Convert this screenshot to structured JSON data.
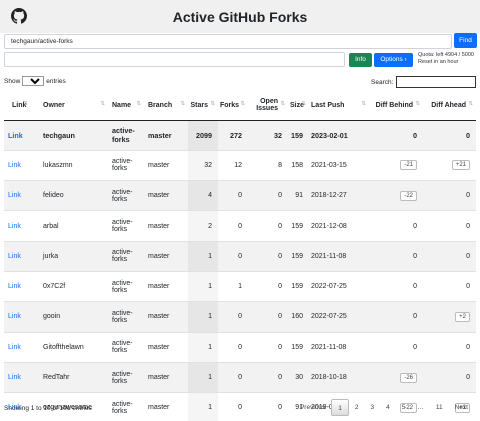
{
  "header": {
    "title": "Active GitHub Forks",
    "logo_icon": "github-octocat-icon"
  },
  "search_bar": {
    "value": "techgaun/active-forks",
    "find_label": "Find"
  },
  "actions": {
    "info_label": "Info",
    "options_label": "Options ›",
    "quota_line1": "Quota: left 4904 / 5000",
    "quota_line2": "Reset in an hour"
  },
  "table_controls": {
    "show_label": "Show",
    "page_size": "10",
    "entries_label": "entries",
    "search_label": "Search:"
  },
  "columns": [
    "Link",
    "Owner",
    "Name",
    "Branch",
    "Stars",
    "Forks",
    "Open Issues",
    "Size",
    "Last Push",
    "Diff Behind",
    "Diff Ahead"
  ],
  "rows": [
    {
      "link": "Link",
      "owner": "techgaun",
      "name": "active-forks",
      "branch": "master",
      "stars": "2099",
      "forks": "272",
      "issues": "32",
      "size": "159",
      "push": "2023-02-01",
      "behind": "0",
      "ahead": "0"
    },
    {
      "link": "Link",
      "owner": "lukaszmn",
      "name": "active-forks",
      "branch": "master",
      "stars": "32",
      "forks": "12",
      "issues": "8",
      "size": "158",
      "push": "2021-03-15",
      "behind": "-21",
      "ahead": "+21"
    },
    {
      "link": "Link",
      "owner": "felideo",
      "name": "active-forks",
      "branch": "master",
      "stars": "4",
      "forks": "0",
      "issues": "0",
      "size": "91",
      "push": "2018-12-27",
      "behind": "-22",
      "ahead": "0"
    },
    {
      "link": "Link",
      "owner": "arbal",
      "name": "active-forks",
      "branch": "master",
      "stars": "2",
      "forks": "0",
      "issues": "0",
      "size": "159",
      "push": "2021-12-08",
      "behind": "0",
      "ahead": "0"
    },
    {
      "link": "Link",
      "owner": "jurka",
      "name": "active-forks",
      "branch": "master",
      "stars": "1",
      "forks": "0",
      "issues": "0",
      "size": "159",
      "push": "2021-11-08",
      "behind": "0",
      "ahead": "0"
    },
    {
      "link": "Link",
      "owner": "0x7C2f",
      "name": "active-forks",
      "branch": "master",
      "stars": "1",
      "forks": "1",
      "issues": "0",
      "size": "159",
      "push": "2022-07-25",
      "behind": "0",
      "ahead": "0"
    },
    {
      "link": "Link",
      "owner": "gooin",
      "name": "active-forks",
      "branch": "master",
      "stars": "1",
      "forks": "0",
      "issues": "0",
      "size": "160",
      "push": "2022-07-25",
      "behind": "0",
      "ahead": "+2"
    },
    {
      "link": "Link",
      "owner": "Gitoffthelawn",
      "name": "active-forks",
      "branch": "master",
      "stars": "1",
      "forks": "0",
      "issues": "0",
      "size": "159",
      "push": "2021-11-08",
      "behind": "0",
      "ahead": "0"
    },
    {
      "link": "Link",
      "owner": "RedTahr",
      "name": "active-forks",
      "branch": "master",
      "stars": "1",
      "forks": "0",
      "issues": "0",
      "size": "30",
      "push": "2018-10-18",
      "behind": "-26",
      "ahead": "0"
    },
    {
      "link": "Link",
      "owner": "ozgunawesome",
      "name": "active-forks",
      "branch": "master",
      "stars": "1",
      "forks": "0",
      "issues": "0",
      "size": "91",
      "push": "2019-01-12",
      "behind": "-22",
      "ahead": "+1"
    }
  ],
  "footer": {
    "info": "Showing 1 to 10 of 101 entries",
    "pages": [
      "Previous",
      "1",
      "2",
      "3",
      "4",
      "5",
      "…",
      "11",
      "Next"
    ],
    "active_page": "1"
  },
  "colors": {
    "primary": "#0d6efd",
    "success": "#198754",
    "header_bg": "#f0f0f0"
  }
}
